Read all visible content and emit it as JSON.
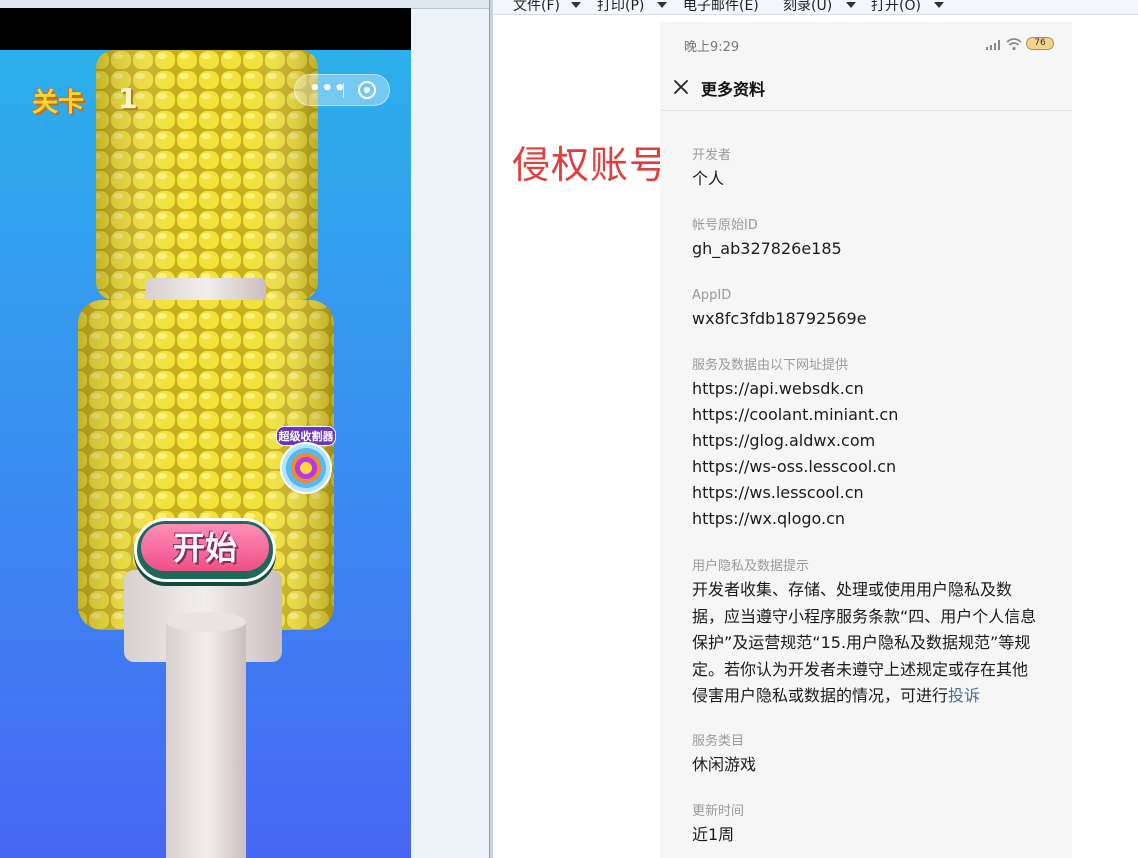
{
  "colors": {
    "sky_top": "#2ab3ea",
    "sky_bottom": "#4766f3",
    "corn_yellow": "#f0e038",
    "start_pink": "#ef4f86",
    "watermark_red": "#e23e3e",
    "link_blue": "#4f6b95"
  },
  "game": {
    "level_label": "关卡",
    "level_number": "1",
    "more_icon": "more-dots-icon",
    "close_icon": "capsule-close-icon",
    "powerup_label": "超级收割器",
    "start_button": "开始"
  },
  "menubar": {
    "items": [
      {
        "label": "文件(F)"
      },
      {
        "label": "打印(P)"
      },
      {
        "label": "电子邮件(E)"
      },
      {
        "label": "刻录(U)"
      },
      {
        "label": "打开(O)"
      }
    ]
  },
  "watermark": "侵权账号",
  "panel": {
    "status_time": "晚上9:29",
    "battery": "76",
    "title": "更多资料",
    "developer": {
      "label": "开发者",
      "value": "个人"
    },
    "original_id": {
      "label": "帐号原始ID",
      "value": "gh_ab327826e185"
    },
    "appid": {
      "label": "AppID",
      "value": "wx8fc3fdb18792569e"
    },
    "service_urls": {
      "label": "服务及数据由以下网址提供",
      "urls": [
        "https://api.websdk.cn",
        "https://coolant.miniant.cn",
        "https://glog.aldwx.com",
        "https://ws-oss.lesscool.cn",
        "https://ws.lesscool.cn",
        "https://wx.qlogo.cn"
      ]
    },
    "privacy": {
      "label": "用户隐私及数据提示",
      "text": "开发者收集、存储、处理或使用用户隐私及数据，应当遵守小程序服务条款“四、用户个人信息保护”及运营规范“15.用户隐私及数据规范”等规定。若你认为开发者未遵守上述规定或存在其他侵害用户隐私或数据的情况，可进行",
      "link": "投诉"
    },
    "category": {
      "label": "服务类目",
      "value": "休闲游戏"
    },
    "updated": {
      "label": "更新时间",
      "value": "近1周"
    }
  }
}
